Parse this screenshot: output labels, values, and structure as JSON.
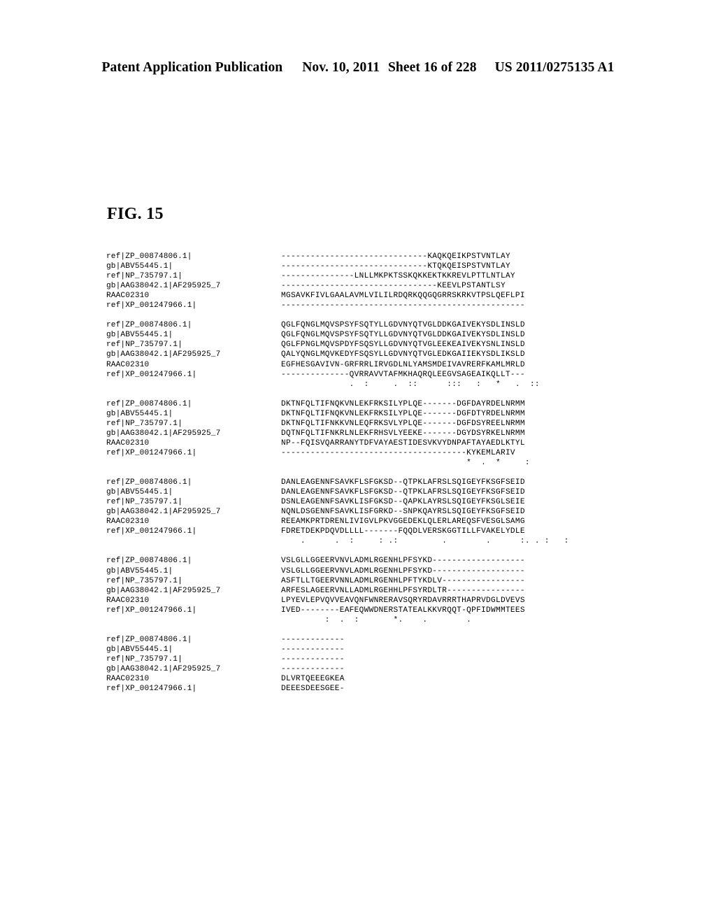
{
  "header": {
    "publication": "Patent Application Publication",
    "date": "Nov. 10, 2011",
    "sheet": "Sheet 16 of 228",
    "number": "US 2011/0275135 A1"
  },
  "figure": {
    "label": "FIG. 15"
  },
  "alignment": {
    "labels": [
      "ref|ZP_00874806.1|",
      "gb|ABV55445.1|",
      "ref|NP_735797.1|",
      "gb|AAG38042.1|AF295925_7",
      "RAAC02310",
      "ref|XP_001247966.1|"
    ],
    "blocks": [
      {
        "sequences": [
          "------------------------------KAQKQEIKPSTVNTLAY",
          "------------------------------KTQKQEISPSTVNTLAY",
          "---------------LNLLMKPKTSSKQKKEKTKKREVLPTTLNTLAY",
          "--------------------------------KEEVLPSTANTLSY",
          "MGSAVKFIVLGAALAVMLVILILRDQRKQQGQGRRSKRKVTPSLQEFLPI",
          "--------------------------------------------------"
        ],
        "conservation": ""
      },
      {
        "sequences": [
          "QGLFQNGLMQVSPSYFSQTYLLGDVNYQTVGLDDKGAIVEKYSDLINSLD",
          "QGLFQNGLMQVSPSYFSQTYLLGDVNYQTVGLDDKGAIVEKYSDLINSLD",
          "QGLFPNGLMQVSPDYFSQSYLLGDVNYQTVGLEEKEAIVEKYSNLINSLD",
          "QALYQNGLMQVKEDYFSQSYLLGDVNYQTVGLEDKGAIIEKYSDLIKSLD",
          "EGFHESGAVIVN-GRFRRLIRVGDLNLYAMSMDEIVAVRERFKAMLMRLD",
          "--------------QVRRAVVTAFMKHAQRQLEEGVSAGEAIKQLLT---"
        ],
        "conservation": "              .  :     .  ::      :::   :   *   .  ::"
      },
      {
        "sequences": [
          "DKTNFQLTIFNQKVNLEKFRKSILYPLQE-------DGFDAYRDELNRMM",
          "DKTNFQLTIFNQKVNLEKFRKSILYPLQE-------DGFDTYRDELNRMM",
          "DKTNFQLTIFNKKVNLEQFRKSVLYPLQE-------DGFDSYREELNRMM",
          "DQTNFQLTIFNKRLNLEKFRHSVLYEEKE-------DGYDSYRKELNRMM",
          "NP--FQISVQARRANYTDFVAYAESTIDESVKVYDNPAFTAYAEDLKTYL",
          "--------------------------------------KYKEMLARIV"
        ],
        "conservation": "                                      *  .  *     :"
      },
      {
        "sequences": [
          "DANLEAGENNFSAVKFLSFGKSD--QTPKLAFRSLSQIGEYFKSGFSEID",
          "DANLEAGENNFSAVKFLSFGKSD--QTPKLAFRSLSQIGEYFKSGFSEID",
          "DSNLEAGENNFSAVKLISFGKSD--QAPKLAYRSLSQIGEYFKSGLSEIE",
          "NQNLDSGENNFSAVKLISFGRKD--SNPKQAYRSLSQIGEYFKSGFSEID",
          "REEAMKPRTDRENLIVIGVLPKVGGEDEKLQLERLAREQSFVESGLSAMG",
          "FDRETDEKPDQVDLLLL-------FQQDLVERSKGGTILLFVAKELYDLE"
        ],
        "conservation": "    .      .  :     : .:         .        .      :. . :   :"
      },
      {
        "sequences": [
          "VSLGLLGGEERVNVLADMLRGENHLPFSYKD-------------------",
          "VSLGLLGGEERVNVLADMLRGENHLPFSYKD-------------------",
          "ASFTLLTGEERVNNLADMLRGENHLPFTYKDLV-----------------",
          "ARFESLAGEERVNLLADMLRGEHHLPFSYRDLTR----------------",
          "LPYEVLEPVQVVEAVQNFWNRERAVSQRYRDAVRRRTHAPRVDGLDVEVS",
          "IVED--------EAFEQWWDNERSTATEALKKVRQQT-QPFIDWMMTEES"
        ],
        "conservation": "         :  .  :       *.    .        ."
      },
      {
        "sequences": [
          "-------------",
          "-------------",
          "-------------",
          "-------------",
          "DLVRTQEEEGKEA",
          "DEEESDEESGEE-"
        ],
        "conservation": ""
      }
    ]
  }
}
